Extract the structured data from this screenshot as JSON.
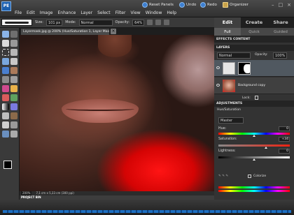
{
  "app": {
    "logo_text": "PE",
    "menu": [
      "File",
      "Edit",
      "Image",
      "Enhance",
      "Layer",
      "Select",
      "Filter",
      "View",
      "Window",
      "Help"
    ],
    "top_buttons": {
      "reset_panels": "Reset Panels",
      "undo": "Undo",
      "redo": "Redo",
      "organizer": "Organizer"
    }
  },
  "options_bar": {
    "size_label": "Size:",
    "size_value": "101 px",
    "mode_label": "Mode:",
    "mode_value": "Normal",
    "opacity_label": "Opacity:",
    "opacity_value": "64%"
  },
  "right_tabs": [
    "Edit",
    "Create",
    "Share"
  ],
  "sub_tabs": [
    "Full",
    "Quick",
    "Guided"
  ],
  "document": {
    "tab_label": "Layermask.jpg @ 200% (Hue/Saturation 1, Layer Mask/8)",
    "close_glyph": "×",
    "zoom": "200%",
    "doc_info": "7,1 cm x 5,33 cm (300 ppi)",
    "project_bin_label": "PROJECT BIN"
  },
  "panels": {
    "effects_header": "EFFECTS  CONTENT",
    "layers_header": "LAYERS",
    "blend_mode": "Normal",
    "opacity_label": "Opacity:",
    "opacity_value": "100%",
    "layers": [
      {
        "name": ""
      },
      {
        "name": "Background copy"
      }
    ],
    "lock_label": "Lock:",
    "adjustments_header": "ADJUSTMENTS",
    "adjustment_name": "Hue/Saturation",
    "preset_value": "Master",
    "hue_label": "Hue:",
    "hue_value": "0",
    "saturation_label": "Saturation:",
    "saturation_value": "+34",
    "lightness_label": "Lightness:",
    "lightness_value": "0",
    "colorize_label": "Colorize"
  },
  "colors": {
    "accent": "#1c5fae",
    "fill_red": "#e00808"
  }
}
